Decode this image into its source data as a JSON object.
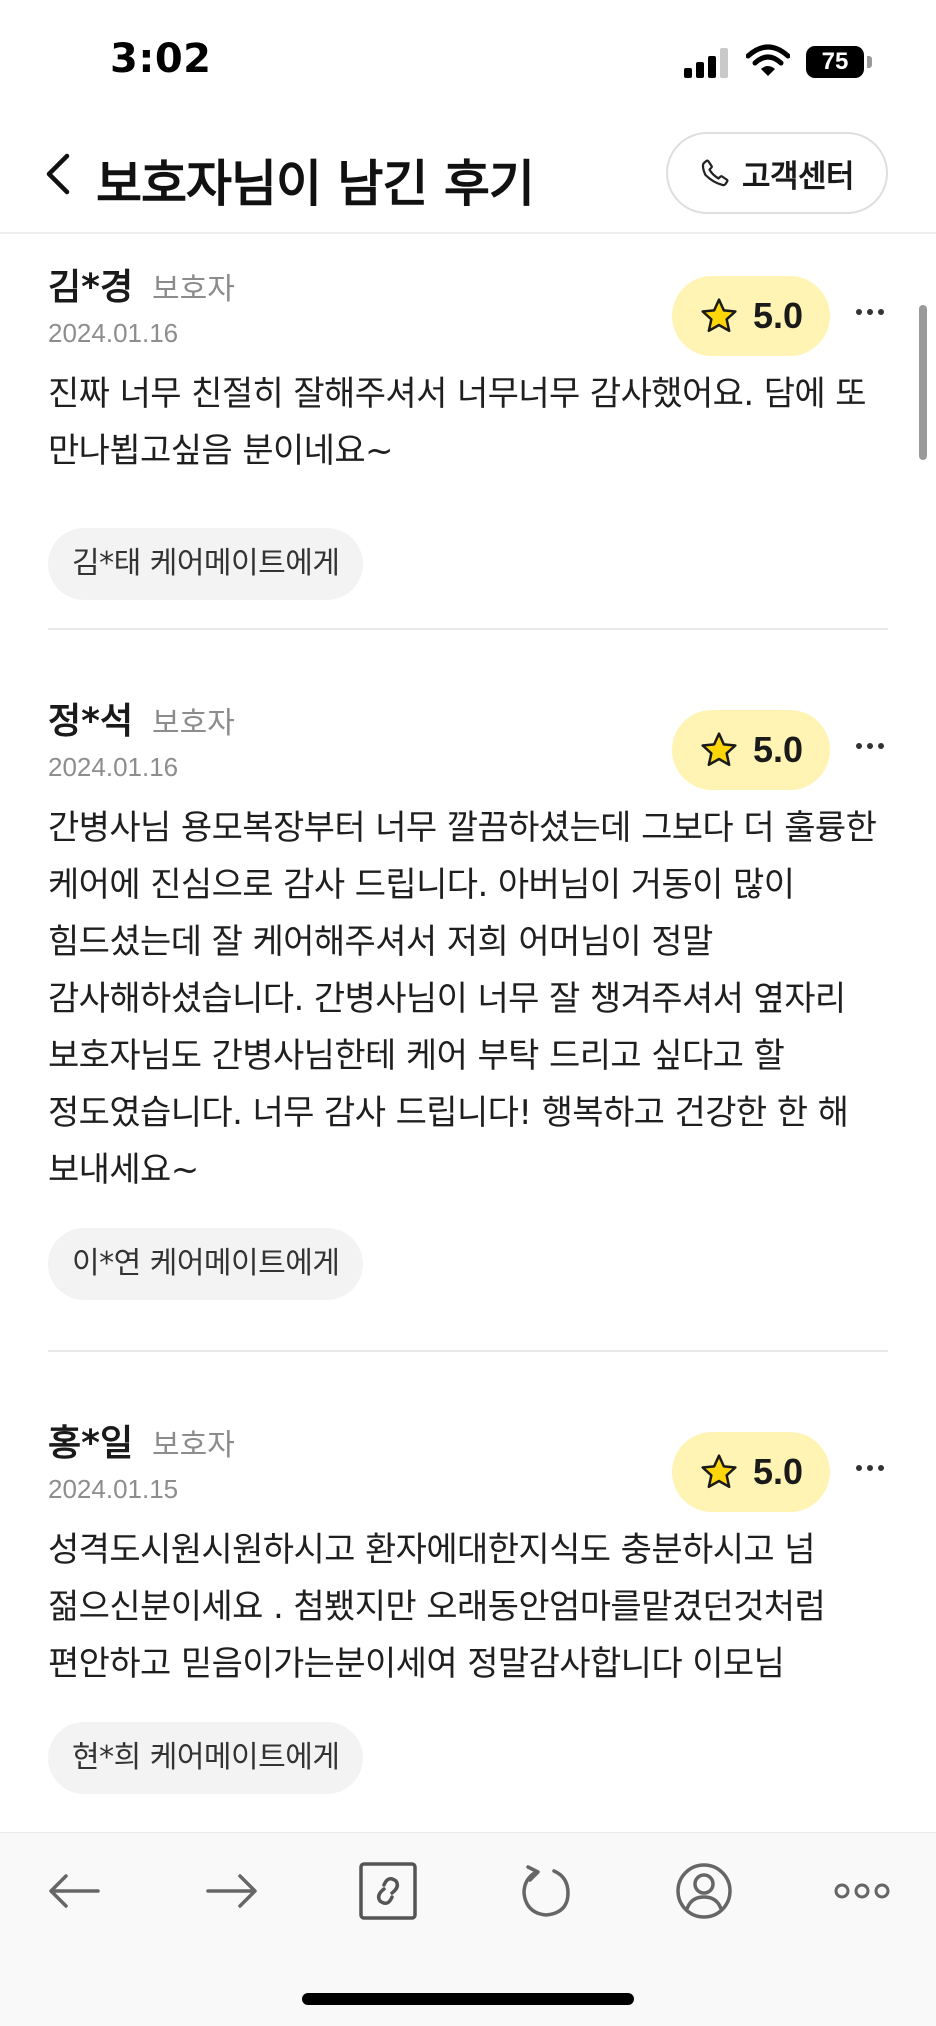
{
  "status_bar": {
    "time": "3:02",
    "battery": "75"
  },
  "header": {
    "title": "보호자님이 남긴 후기",
    "cs_button_label": "고객센터"
  },
  "reviews": [
    {
      "name": "김*경",
      "role": "보호자",
      "date": "2024.01.16",
      "rating": "5.0",
      "body": "진짜 너무 친절히 잘해주셔서 너무너무 감사했어요. 담에 또 만나뵙고싶음 분이네요~",
      "recipient": "김*태 케어메이트에게"
    },
    {
      "name": "정*석",
      "role": "보호자",
      "date": "2024.01.16",
      "rating": "5.0",
      "body": "간병사님 용모복장부터 너무 깔끔하셨는데 그보다 더 훌륭한 케어에 진심으로 감사 드립니다. 아버님이 거동이 많이 힘드셨는데 잘 케어해주셔서 저희 어머님이 정말 감사해하셨습니다. 간병사님이 너무 잘 챙겨주셔서 옆자리 보호자님도 간병사님한테 케어 부탁 드리고 싶다고 할 정도였습니다. 너무 감사 드립니다! 행복하고 건강한 한 해 보내세요~",
      "recipient": "이*연 케어메이트에게"
    },
    {
      "name": "홍*일",
      "role": "보호자",
      "date": "2024.01.15",
      "rating": "5.0",
      "body": "성격도시원시원하시고 환자에대한지식도 충분하시고 넘 젊으신분이세요 . 첨뵀지만 오래동안엄마를맡겼던것처럼 편안하고 믿음이가는분이세여 정말감사합니다 이모님",
      "recipient": "현*희 케어메이트에게"
    }
  ],
  "icons": {
    "back": "chevron-left-icon",
    "phone": "phone-icon",
    "star": "star-icon",
    "more": "more-horizontal-icon"
  },
  "colors": {
    "rating_badge_bg": "#fff4b3",
    "star_fill": "#ffd60a",
    "chip_bg": "#f3f3f3"
  }
}
